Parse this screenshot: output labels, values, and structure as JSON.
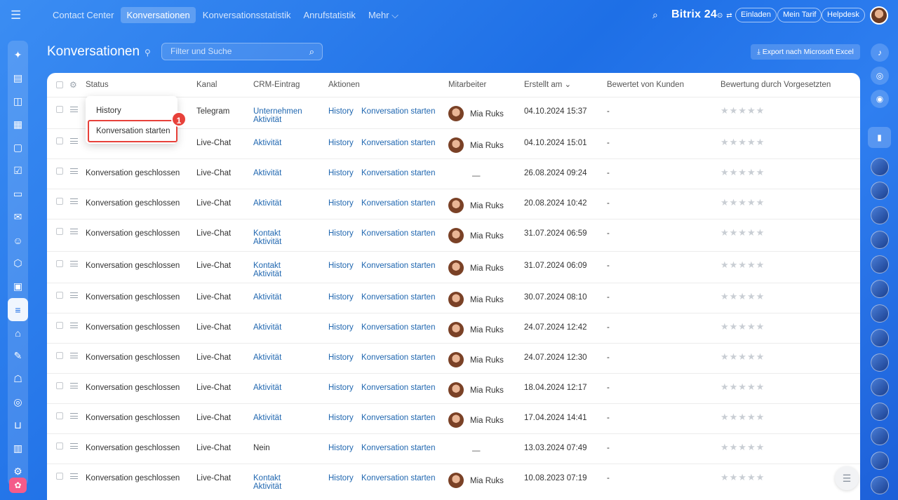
{
  "topnav": {
    "items": [
      "Contact Center",
      "Konversationen",
      "Konversationsstatistik",
      "Anrufstatistik",
      "Mehr ⌵"
    ],
    "active_index": 1
  },
  "topright": {
    "brand": "Bitrix 24",
    "brand_suffix": "⊙",
    "invite": "Einladen",
    "tariff": "Mein Tarif",
    "helpdesk": "Helpdesk"
  },
  "page": {
    "title": "Konversationen",
    "search_placeholder": "Filter und Suche",
    "export_label": "Export nach Microsoft Excel"
  },
  "table": {
    "headers": [
      "Status",
      "Kanal",
      "CRM-Eintrag",
      "Aktionen",
      "Mitarbeiter",
      "Erstellt am ⌄",
      "Bewertet von Kunden",
      "Bewertung durch Vorgesetzten"
    ],
    "rows": [
      {
        "status": "",
        "kanal": "Telegram",
        "crm": [
          "Unternehmen",
          "Aktivität"
        ],
        "history": "History",
        "start": "Konversation starten",
        "employee": "Mia Ruks",
        "created": "04.10.2024 15:37",
        "rated": "-"
      },
      {
        "status": "",
        "kanal": "Live-Chat",
        "crm": [
          "Aktivität"
        ],
        "history": "History",
        "start": "Konversation starten",
        "employee": "Mia Ruks",
        "created": "04.10.2024 15:01",
        "rated": "-"
      },
      {
        "status": "Konversation geschlossen",
        "kanal": "Live-Chat",
        "crm": [
          "Aktivität"
        ],
        "history": "History",
        "start": "Konversation starten",
        "employee": "—",
        "created": "26.08.2024 09:24",
        "rated": "-"
      },
      {
        "status": "Konversation geschlossen",
        "kanal": "Live-Chat",
        "crm": [
          "Aktivität"
        ],
        "history": "History",
        "start": "Konversation starten",
        "employee": "Mia Ruks",
        "created": "20.08.2024 10:42",
        "rated": "-"
      },
      {
        "status": "Konversation geschlossen",
        "kanal": "Live-Chat",
        "crm": [
          "Kontakt",
          "Aktivität"
        ],
        "history": "History",
        "start": "Konversation starten",
        "employee": "Mia Ruks",
        "created": "31.07.2024 06:59",
        "rated": "-"
      },
      {
        "status": "Konversation geschlossen",
        "kanal": "Live-Chat",
        "crm": [
          "Kontakt",
          "Aktivität"
        ],
        "history": "History",
        "start": "Konversation starten",
        "employee": "Mia Ruks",
        "created": "31.07.2024 06:09",
        "rated": "-"
      },
      {
        "status": "Konversation geschlossen",
        "kanal": "Live-Chat",
        "crm": [
          "Aktivität"
        ],
        "history": "History",
        "start": "Konversation starten",
        "employee": "Mia Ruks",
        "created": "30.07.2024 08:10",
        "rated": "-"
      },
      {
        "status": "Konversation geschlossen",
        "kanal": "Live-Chat",
        "crm": [
          "Aktivität"
        ],
        "history": "History",
        "start": "Konversation starten",
        "employee": "Mia Ruks",
        "created": "24.07.2024 12:42",
        "rated": "-"
      },
      {
        "status": "Konversation geschlossen",
        "kanal": "Live-Chat",
        "crm": [
          "Aktivität"
        ],
        "history": "History",
        "start": "Konversation starten",
        "employee": "Mia Ruks",
        "created": "24.07.2024 12:30",
        "rated": "-"
      },
      {
        "status": "Konversation geschlossen",
        "kanal": "Live-Chat",
        "crm": [
          "Aktivität"
        ],
        "history": "History",
        "start": "Konversation starten",
        "employee": "Mia Ruks",
        "created": "18.04.2024 12:17",
        "rated": "-"
      },
      {
        "status": "Konversation geschlossen",
        "kanal": "Live-Chat",
        "crm": [
          "Aktivität"
        ],
        "history": "History",
        "start": "Konversation starten",
        "employee": "Mia Ruks",
        "created": "17.04.2024 14:41",
        "rated": "-"
      },
      {
        "status": "Konversation geschlossen",
        "kanal": "Live-Chat",
        "crm": [
          "Nein"
        ],
        "history": "History",
        "start": "Konversation starten",
        "employee": "—",
        "created": "13.03.2024 07:49",
        "rated": "-"
      },
      {
        "status": "Konversation geschlossen",
        "kanal": "Live-Chat",
        "crm": [
          "Kontakt",
          "Aktivität"
        ],
        "history": "History",
        "start": "Konversation starten",
        "employee": "Mia Ruks",
        "created": "10.08.2023 07:19",
        "rated": "-"
      }
    ]
  },
  "popup": {
    "history": "History",
    "start": "Konversation starten",
    "badge": "1"
  },
  "colors": {
    "accent": "#2067b0",
    "highlight": "#e7413a"
  }
}
